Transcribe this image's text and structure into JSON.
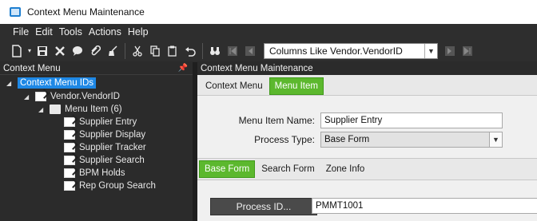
{
  "window": {
    "title": "Context Menu Maintenance"
  },
  "menubar": {
    "items": [
      "File",
      "Edit",
      "Tools",
      "Actions",
      "Help"
    ]
  },
  "toolbar": {
    "search_value": "Columns Like Vendor.VendorID"
  },
  "left_panel": {
    "header": "Context Menu",
    "tree": {
      "root": "Context Menu IDs",
      "node": "Vendor.VendorID",
      "folder": "Menu Item (6)",
      "items": [
        "Supplier Entry",
        "Supplier Display",
        "Supplier Tracker",
        "Supplier Search",
        "BPM Holds",
        "Rep Group Search"
      ]
    }
  },
  "right_panel": {
    "header": "Context Menu Maintenance",
    "tabs": [
      "Context Menu",
      "Menu Item"
    ],
    "form": {
      "menu_item_name_label": "Menu Item Name:",
      "menu_item_name_value": "Supplier Entry",
      "process_type_label": "Process Type:",
      "process_type_value": "Base Form"
    },
    "subtabs": [
      "Base Form",
      "Search Form",
      "Zone Info"
    ],
    "process": {
      "button_label": "Process ID...",
      "value": "PMMT1001"
    }
  },
  "colors": {
    "accent_green": "#5cb82e",
    "selection_blue": "#1e88e5"
  }
}
